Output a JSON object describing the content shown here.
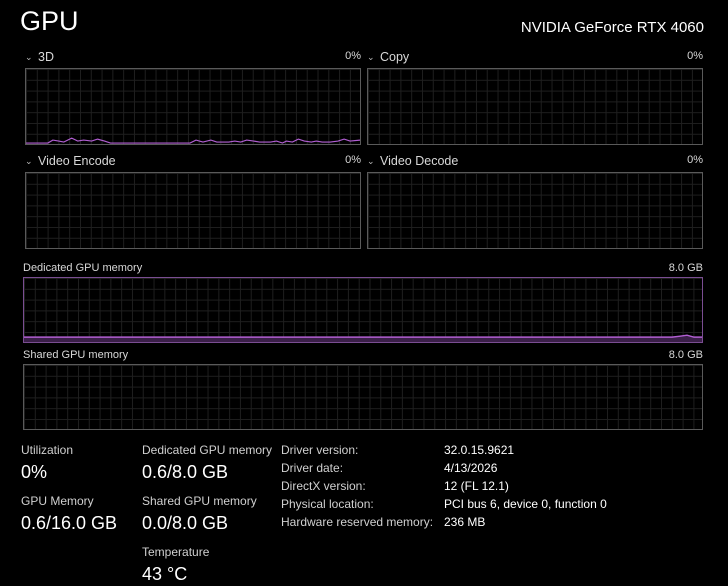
{
  "header": {
    "title": "GPU",
    "device_name": "NVIDIA GeForce RTX 4060"
  },
  "engines": [
    {
      "label": "3D",
      "percent": "0%"
    },
    {
      "label": "Copy",
      "percent": "0%"
    },
    {
      "label": "Video Encode",
      "percent": "0%"
    },
    {
      "label": "Video Decode",
      "percent": "0%"
    }
  ],
  "memory_graphs": {
    "dedicated": {
      "label": "Dedicated GPU memory",
      "max": "8.0 GB"
    },
    "shared": {
      "label": "Shared GPU memory",
      "max": "8.0 GB"
    }
  },
  "stats": {
    "utilization": {
      "label": "Utilization",
      "value": "0%"
    },
    "gpu_memory": {
      "label": "GPU Memory",
      "value": "0.6/16.0 GB"
    },
    "dedicated_memory": {
      "label": "Dedicated GPU memory",
      "value": "0.6/8.0 GB"
    },
    "shared_memory": {
      "label": "Shared GPU memory",
      "value": "0.0/8.0 GB"
    },
    "temperature": {
      "label": "Temperature",
      "value": "43 °C"
    }
  },
  "details": [
    {
      "label": "Driver version:",
      "value": "32.0.15.9621"
    },
    {
      "label": "Driver date:",
      "value": "4/13/2026"
    },
    {
      "label": "DirectX version:",
      "value": "12 (FL 12.1)"
    },
    {
      "label": "Physical location:",
      "value": "PCI bus 6, device 0, function 0"
    },
    {
      "label": "Hardware reserved memory:",
      "value": "236 MB"
    }
  ],
  "colors": {
    "graph_line": "#b25fd3",
    "graph_border": "#5a5a5a",
    "grid": "#1f1f1f"
  }
}
